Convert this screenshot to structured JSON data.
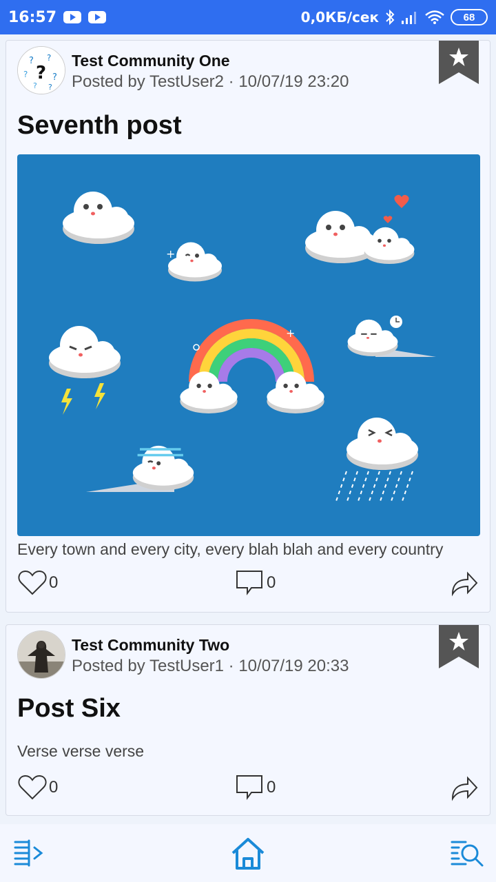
{
  "status_bar": {
    "time": "16:57",
    "network_speed": "0,0КБ/сек",
    "battery": "68",
    "icons": [
      "youtube-icon",
      "youtube-icon",
      "bluetooth-icon",
      "signal-icon",
      "wifi-icon",
      "battery-icon"
    ]
  },
  "posts": [
    {
      "community": "Test Community One",
      "meta": "Posted by TestUser2 · 10/07/19 23:20",
      "title": "Seventh post",
      "has_image": true,
      "body": "Every town and every city, every blah blah and every country",
      "likes": "0",
      "comments": "0"
    },
    {
      "community": "Test Community Two",
      "meta": "Posted by TestUser1 · 10/07/19 20:33",
      "title": "Post Six",
      "has_image": false,
      "body": "Verse verse verse",
      "likes": "0",
      "comments": "0"
    }
  ],
  "bottom_nav": {
    "items": [
      "feeds-icon",
      "home-icon",
      "search-icon"
    ],
    "active": "home-icon"
  },
  "colors": {
    "status_bar": "#2f6ef0",
    "accent": "#1a8ad8",
    "image_background": "#1f7dbf"
  }
}
